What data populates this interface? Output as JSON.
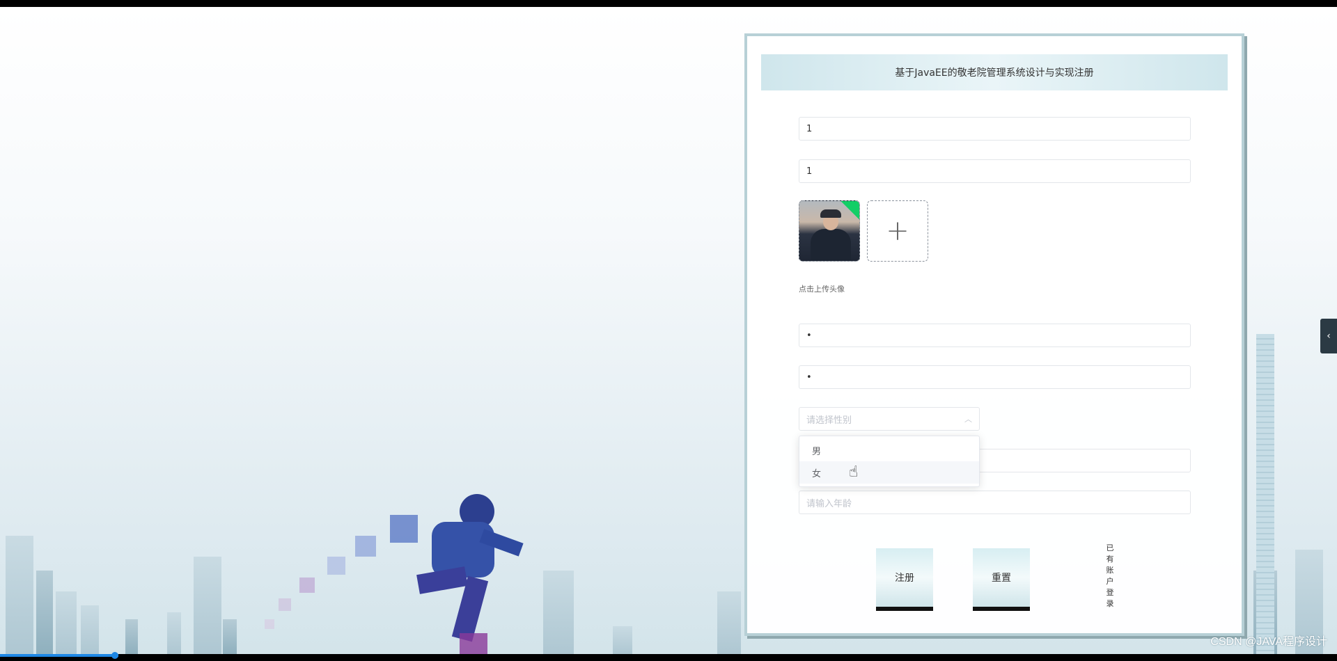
{
  "form": {
    "title": "基于JavaEE的敬老院管理系统设计与实现注册",
    "account_value": "1",
    "name_value": "1",
    "upload_hint": "点击上传头像",
    "password_value": "•",
    "confirm_password_value": "•",
    "gender_placeholder": "请选择性别",
    "gender_options": [
      "男",
      "女"
    ],
    "age_placeholder": "请输入年龄",
    "register_label": "注册",
    "reset_label": "重置",
    "login_link": "已有账户登录"
  },
  "watermark": "CSDN @JAVA程序设计",
  "colors": {
    "card_border": "#b7d0d6",
    "upload_success": "#13ce66",
    "button_gradient": "#d7eef2",
    "progress": "#1e88e5"
  },
  "icons": {
    "add": "plus-icon",
    "select_arrow": "chevron-up-icon",
    "sidebar": "chevron-left-icon",
    "cursor": "hand-pointer-icon"
  }
}
